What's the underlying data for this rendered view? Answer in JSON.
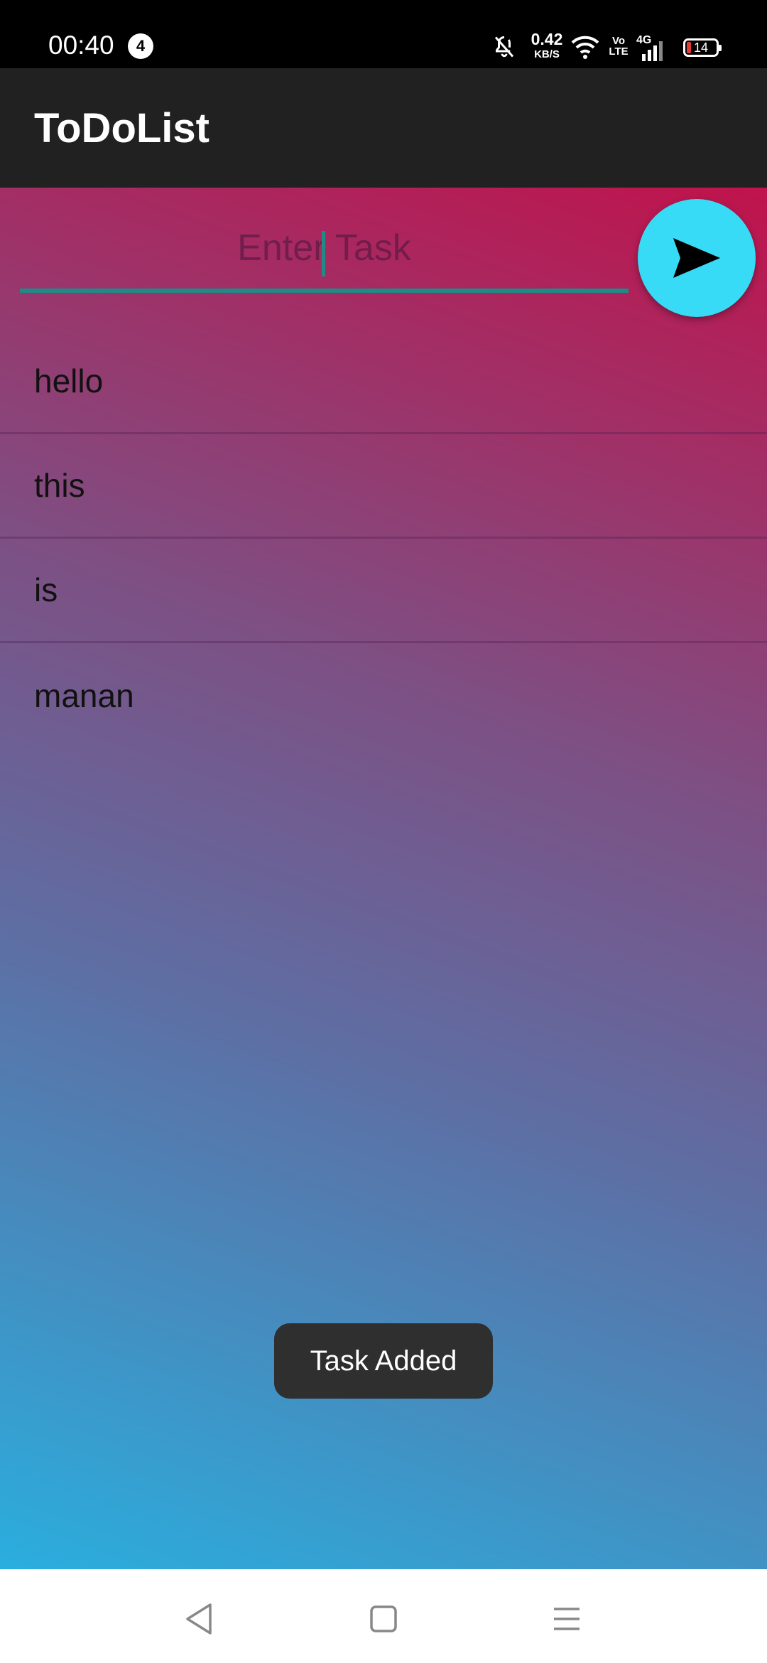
{
  "status_bar": {
    "time": "00:40",
    "notification_count": "4",
    "net_speed_value": "0.42",
    "net_speed_unit": "KB/S",
    "volte_line1": "Vo",
    "volte_line2": "LTE",
    "network": "4G",
    "battery_level": "14"
  },
  "app_bar": {
    "title": "ToDoList"
  },
  "task_input": {
    "placeholder": "Enter Task",
    "value": ""
  },
  "add_button": {
    "icon": "send-icon",
    "color": "#37dbf5"
  },
  "tasks": [
    {
      "text": "hello"
    },
    {
      "text": "this"
    },
    {
      "text": "is"
    },
    {
      "text": "manan"
    }
  ],
  "toast": {
    "message": "Task Added"
  },
  "nav_bar": {
    "back_icon": "back-triangle-icon",
    "home_icon": "home-square-icon",
    "menu_icon": "recents-menu-icon"
  },
  "colors": {
    "accent_underline": "#1f8a86",
    "app_bar_bg": "#212121",
    "gradient_top": "#c0134c",
    "gradient_bottom": "#2aaede"
  }
}
